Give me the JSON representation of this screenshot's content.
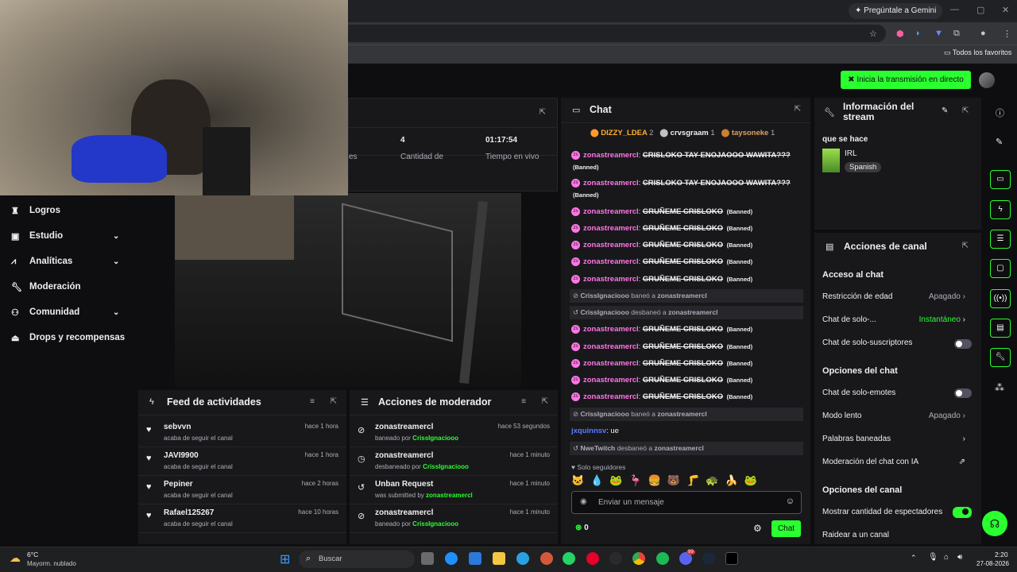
{
  "browser": {
    "gemini_label": "Pregúntale a Gemini",
    "bookmarks_label": "Todos los favoritos"
  },
  "header": {
    "go_live": "Inicia la transmisión en directo"
  },
  "stats": [
    {
      "value": "",
      "label": "es"
    },
    {
      "value": "4",
      "label": "Cantidad de"
    },
    {
      "value": "01:17:54",
      "label": "Tiempo en vivo"
    }
  ],
  "sidebar": {
    "items": [
      {
        "label": "Logros",
        "icon": "trophy-icon",
        "expandable": false
      },
      {
        "label": "Estudio",
        "icon": "studio-icon",
        "expandable": true
      },
      {
        "label": "Analíticas",
        "icon": "analytics-icon",
        "expandable": true
      },
      {
        "label": "Moderación",
        "icon": "wrench-icon",
        "expandable": false
      },
      {
        "label": "Comunidad",
        "icon": "community-icon",
        "expandable": true
      },
      {
        "label": "Drops y recompensas",
        "icon": "drops-icon",
        "expandable": false
      }
    ]
  },
  "activity_feed": {
    "title": "Feed de actividades",
    "rows": [
      {
        "name": "sebvvn",
        "sub": "acaba de seguir el canal",
        "time": "hace 1 hora"
      },
      {
        "name": "JAVI9900",
        "sub": "acaba de seguir el canal",
        "time": "hace 1 hora"
      },
      {
        "name": "Pepiner",
        "sub": "acaba de seguir el canal",
        "time": "hace 2 horas"
      },
      {
        "name": "Rafael125267",
        "sub": "acaba de seguir el canal",
        "time": "hace 10 horas"
      }
    ]
  },
  "mod_actions": {
    "title": "Acciones de moderador",
    "rows": [
      {
        "name": "zonastreamercl",
        "sub_prefix": "baneado por",
        "sub_user": "CrissIgnaciooo",
        "time": "hace 53 segundos",
        "icon": "ban-icon"
      },
      {
        "name": "zonastreamercl",
        "sub_prefix": "desbaneado por",
        "sub_user": "CrissIgnaciooo",
        "time": "hace 1 minuto",
        "icon": "clock-icon"
      },
      {
        "name": "Unban Request",
        "sub_prefix": "was submitted by",
        "sub_user": "zonastreamercl",
        "time": "hace 1 minuto",
        "icon": "undo-icon"
      },
      {
        "name": "zonastreamercl",
        "sub_prefix": "baneado por",
        "sub_user": "CrissIgnaciooo",
        "time": "hace 1 minuto",
        "icon": "ban-icon"
      }
    ]
  },
  "chat": {
    "title": "Chat",
    "leaderboard": [
      {
        "name": "DIZZY_LDEA",
        "count": "2"
      },
      {
        "name": "crvsgraam",
        "count": "1"
      },
      {
        "name": "taysoneke",
        "count": "1"
      }
    ],
    "messages": [
      {
        "user": "zonastreamercl",
        "text": "CRISLOKO TAY ENOJAOOO WAWITA???",
        "tag": "(Banned)"
      },
      {
        "user": "zonastreamercl",
        "text": "CRISLOKO TAY ENOJAOOO WAWITA???",
        "tag": "(Banned)"
      },
      {
        "user": "zonastreamercl",
        "text": "GRUÑEME CRISLOKO",
        "tag": "(Banned)"
      },
      {
        "user": "zonastreamercl",
        "text": "GRUÑEME CRISLOKO",
        "tag": "(Banned)"
      },
      {
        "user": "zonastreamercl",
        "text": "GRUÑEME CRISLOKO",
        "tag": "(Banned)"
      },
      {
        "user": "zonastreamercl",
        "text": "GRUÑEME CRISLOKO",
        "tag": "(Banned)"
      },
      {
        "user": "zonastreamercl",
        "text": "GRUÑEME CRISLOKO",
        "tag": "(Banned)"
      }
    ],
    "mod_events": [
      {
        "actor": "CrissIgnaciooo",
        "action": "baneó a",
        "target": "zonastreamercl"
      },
      {
        "actor": "CrissIgnaciooo",
        "action": "desbaneó a",
        "target": "zonastreamercl"
      }
    ],
    "messages2": [
      {
        "user": "zonastreamercl",
        "text": "GRUÑEME CRISLOKO",
        "tag": "(Banned)"
      },
      {
        "user": "zonastreamercl",
        "text": "GRUÑEME CRISLOKO",
        "tag": "(Banned)"
      },
      {
        "user": "zonastreamercl",
        "text": "GRUÑEME CRISLOKO",
        "tag": "(Banned)"
      },
      {
        "user": "zonastreamercl",
        "text": "GRUÑEME CRISLOKO",
        "tag": "(Banned)"
      },
      {
        "user": "zonastreamercl",
        "text": "GRUÑEME CRISLOKO",
        "tag": "(Banned)"
      }
    ],
    "mod_event3": {
      "actor": "CrissIgnaciooo",
      "action": "baneó a",
      "target": "zonastreamercl"
    },
    "normal_msg": {
      "user": "jxquinnsv",
      "text": "ue"
    },
    "mod_event4": {
      "actor": "NweTwitch",
      "action": "desbaneó a",
      "target": "zonastreamercl"
    },
    "followers_only": "Solo seguidores",
    "input_placeholder": "Enviar un mensaje",
    "points": "0",
    "send_label": "Chat"
  },
  "stream_info": {
    "title": "Información del stream",
    "stream_title": "que se hace",
    "category": "IRL",
    "tag": "Spanish"
  },
  "channel_actions": {
    "title": "Acciones de canal",
    "section1": "Acceso al chat",
    "age": {
      "label": "Restricción de edad",
      "value": "Apagado"
    },
    "followers": {
      "label": "Chat de solo-...",
      "value": "Instantáneo"
    },
    "subs": {
      "label": "Chat de solo-suscriptores"
    },
    "section2": "Opciones del chat",
    "emotes": {
      "label": "Chat de solo-emotes"
    },
    "slow": {
      "label": "Modo lento",
      "value": "Apagado"
    },
    "banned_words": {
      "label": "Palabras baneadas"
    },
    "ai_mod": {
      "label": "Moderación del chat con IA"
    },
    "section3": "Opciones del canal",
    "viewers": {
      "label": "Mostrar cantidad de espectadores"
    },
    "raid": {
      "label": "Raidear a un canal"
    }
  },
  "taskbar": {
    "weather_temp": "6°C",
    "weather_desc": "Mayorm. nublado",
    "search_placeholder": "Buscar",
    "time": "2:20",
    "date": "27-08-2026",
    "discord_badge": "99"
  },
  "colors": {
    "accent": "#2aff30",
    "chat_user": "#ff75e6",
    "bg": "#0e0e10",
    "panel": "#18181b"
  }
}
